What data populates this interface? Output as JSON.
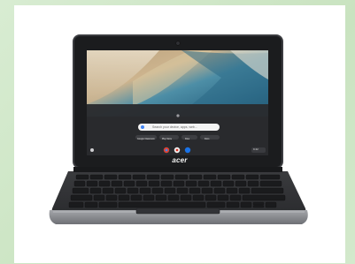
{
  "product": {
    "brand_logo": "acer",
    "device": "Chromebook laptop"
  },
  "screen": {
    "search_placeholder": "Search your device, apps, web...",
    "shortcuts": [
      "Google Classroom",
      "Play Store",
      "Files",
      "Docs"
    ],
    "shelf_time": "9:42"
  },
  "colors": {
    "background": "#d0e7c8",
    "card": "#ffffff",
    "chassis": "#2b2b2d",
    "bezel": "#17181a",
    "bumper": "#8e9094"
  }
}
